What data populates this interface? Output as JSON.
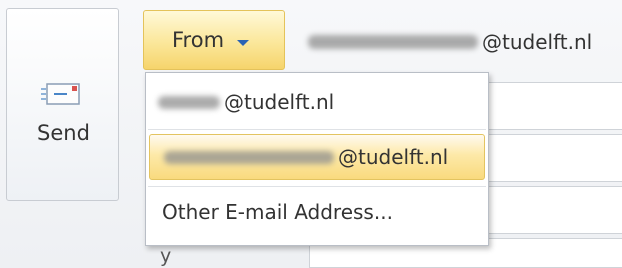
{
  "send": {
    "label": "Send",
    "icon": "envelope-send-icon"
  },
  "from": {
    "label": "From",
    "icon": "chevron-down-icon",
    "current_address_domain": "@tudelft.nl"
  },
  "menu": {
    "items": [
      {
        "domain": "@tudelft.nl",
        "selected": false
      },
      {
        "domain": "@tudelft.nl",
        "selected": true
      },
      {
        "label": "Other E-mail Address..."
      }
    ]
  },
  "fields": {
    "subject_label_fragment": "y"
  },
  "colors": {
    "highlight_top": "#fff9d8",
    "highlight_bottom": "#f6d46c",
    "highlight_border": "#e4c35a",
    "caret": "#2a63b5"
  }
}
